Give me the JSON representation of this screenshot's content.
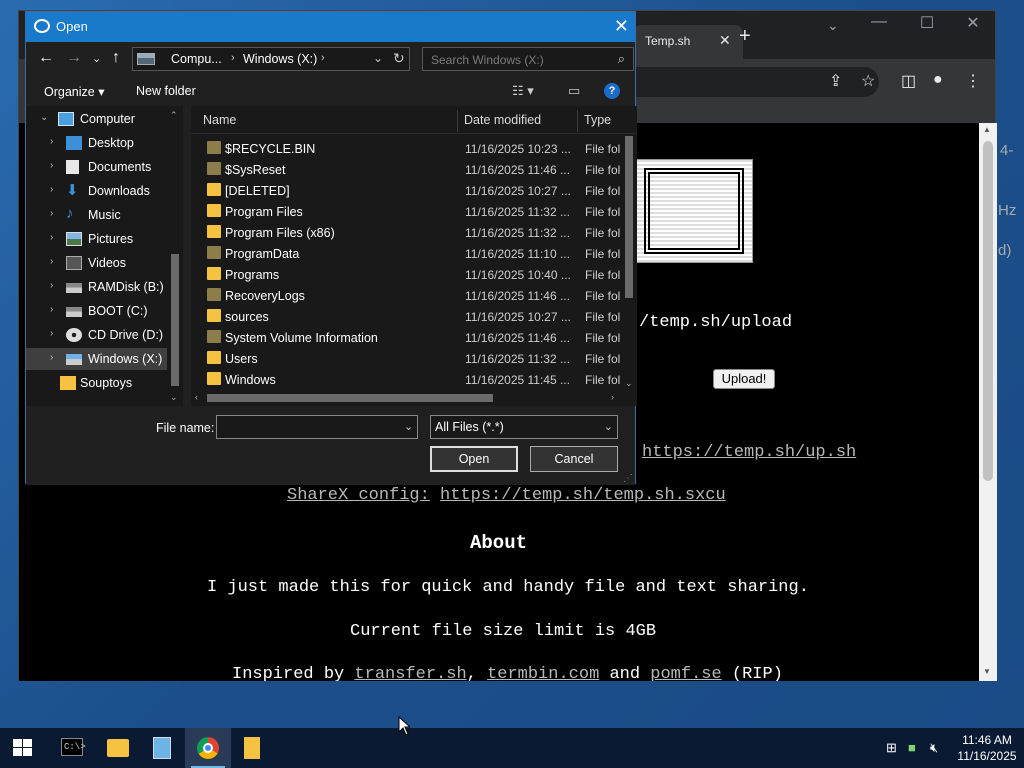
{
  "browser": {
    "tab_title": "Temp.sh",
    "tab_close": "✕",
    "new_tab": "+",
    "page": {
      "upload_url": "/temp.sh/upload",
      "upload_button": "Upload!",
      "script_link": "https://temp.sh/up.sh",
      "sharex_label": "ShareX config:",
      "sharex_link": "https://temp.sh/temp.sh.sxcu",
      "about_heading": "About",
      "about_line1": "I just made this for quick and handy file and text sharing.",
      "about_line2": "Current file size limit is 4GB",
      "inspired_prefix": "Inspired by",
      "link_transfer": "transfer.sh",
      "comma": ",",
      "link_termbin": "termbin.com",
      "and": "and",
      "link_pomf": "pomf.se",
      "rip": "(RIP)",
      "side_frag1": "4-",
      "side_frag2": "Hz",
      "side_frag3": "d)"
    }
  },
  "dialog": {
    "title": "Open",
    "close": "✕",
    "address": {
      "seg1": "Compu...",
      "seg2": "Windows (X:)",
      "sep": "›"
    },
    "search_placeholder": "Search Windows (X:)",
    "organize": "Organize ▾",
    "new_folder": "New folder",
    "help": "?",
    "tree": [
      {
        "label": "Computer",
        "arrow": "⌄",
        "icon": "computer-icon"
      },
      {
        "label": "Desktop",
        "arrow": "›",
        "icon": "desktop-icon"
      },
      {
        "label": "Documents",
        "arrow": "›",
        "icon": "documents-icon"
      },
      {
        "label": "Downloads",
        "arrow": "›",
        "icon": "downloads-icon"
      },
      {
        "label": "Music",
        "arrow": "›",
        "icon": "music-icon"
      },
      {
        "label": "Pictures",
        "arrow": "›",
        "icon": "pictures-icon"
      },
      {
        "label": "Videos",
        "arrow": "›",
        "icon": "videos-icon"
      },
      {
        "label": "RAMDisk (B:)",
        "arrow": "›",
        "icon": "drive-icon"
      },
      {
        "label": "BOOT (C:)",
        "arrow": "›",
        "icon": "drive-icon"
      },
      {
        "label": "CD Drive (D:)",
        "arrow": "›",
        "icon": "cd-drive-icon"
      },
      {
        "label": "Windows (X:)",
        "arrow": "›",
        "icon": "drive-icon"
      },
      {
        "label": "Souptoys",
        "arrow": "",
        "icon": "folder-icon"
      }
    ],
    "columns": {
      "name": "Name",
      "date": "Date modified",
      "type": "Type"
    },
    "files": [
      {
        "name": "$RECYCLE.BIN",
        "date": "11/16/2025 10:23 ...",
        "type": "File fol",
        "hidden": true
      },
      {
        "name": "$SysReset",
        "date": "11/16/2025 11:46 ...",
        "type": "File fol",
        "hidden": true
      },
      {
        "name": "[DELETED]",
        "date": "11/16/2025 10:27 ...",
        "type": "File fol",
        "hidden": false
      },
      {
        "name": "Program Files",
        "date": "11/16/2025 11:32 ...",
        "type": "File fol",
        "hidden": false
      },
      {
        "name": "Program Files (x86)",
        "date": "11/16/2025 11:32 ...",
        "type": "File fol",
        "hidden": false
      },
      {
        "name": "ProgramData",
        "date": "11/16/2025 11:10 ...",
        "type": "File fol",
        "hidden": true
      },
      {
        "name": "Programs",
        "date": "11/16/2025 10:40 ...",
        "type": "File fol",
        "hidden": false
      },
      {
        "name": "RecoveryLogs",
        "date": "11/16/2025 11:46 ...",
        "type": "File fol",
        "hidden": true
      },
      {
        "name": "sources",
        "date": "11/16/2025 10:27 ...",
        "type": "File fol",
        "hidden": false
      },
      {
        "name": "System Volume Information",
        "date": "11/16/2025 11:46 ...",
        "type": "File fol",
        "hidden": true
      },
      {
        "name": "Users",
        "date": "11/16/2025 11:32 ...",
        "type": "File fol",
        "hidden": false
      },
      {
        "name": "Windows",
        "date": "11/16/2025 11:45 ...",
        "type": "File fol",
        "hidden": false
      }
    ],
    "file_name_label": "File name:",
    "file_name_value": "",
    "filter": "All Files (*.*)",
    "open_button": "Open",
    "cancel_button": "Cancel"
  },
  "taskbar": {
    "time": "11:46 AM",
    "date": "11/16/2025",
    "cmd_prompt": "C:\\>"
  },
  "colors": {
    "folder": "#f5c242",
    "hidden_folder": "#8c7d4a",
    "accent": "#1979ca"
  }
}
